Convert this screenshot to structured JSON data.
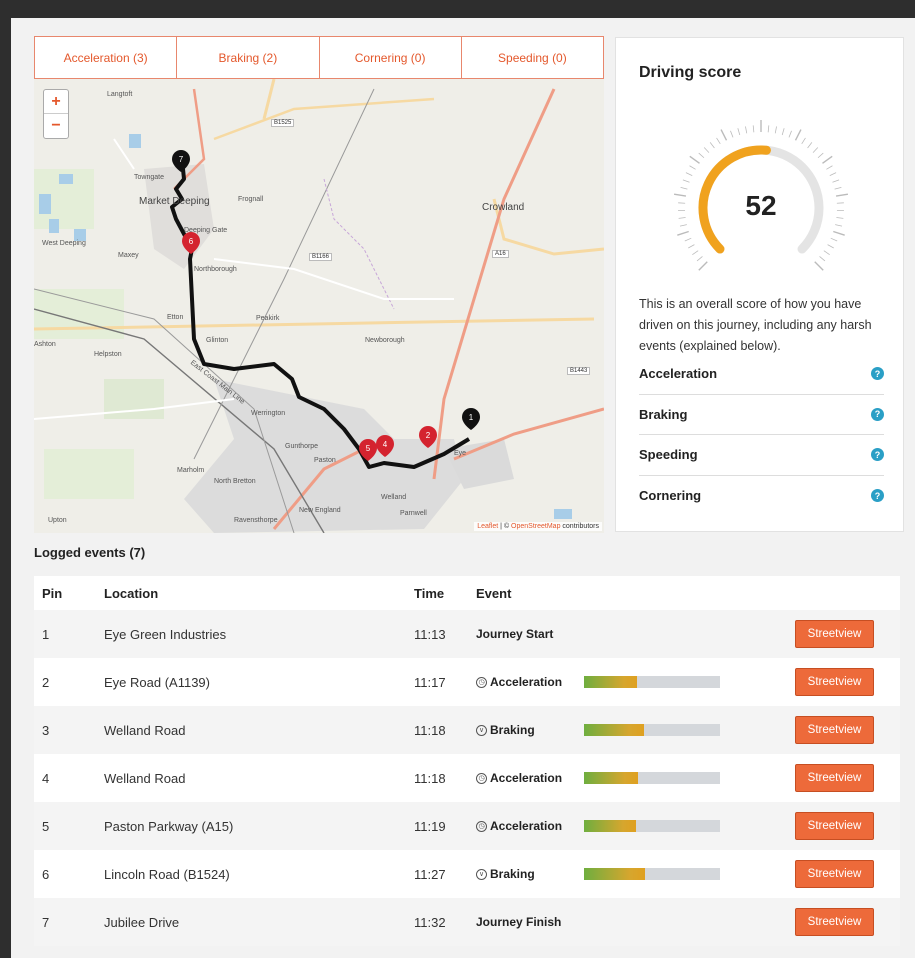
{
  "tabs": [
    {
      "label": "Acceleration (3)"
    },
    {
      "label": "Braking (2)"
    },
    {
      "label": "Cornering (0)"
    },
    {
      "label": "Speeding (0)"
    }
  ],
  "map": {
    "zoom_in": "+",
    "zoom_out": "−",
    "attribution_leaflet": "Leaflet",
    "attribution_sep": " | © ",
    "attribution_osm": "OpenStreetMap",
    "attribution_tail": " contributors",
    "places": {
      "langtoft": "Langtoft",
      "towngate": "Towngate",
      "market_deeping": "Market Deeping",
      "frognall": "Frognall",
      "deeping_gate": "Deeping Gate",
      "west_deeping": "West Deeping",
      "maxey": "Maxey",
      "northborough": "Northborough",
      "etton": "Etton",
      "peakirk": "Peakirk",
      "glinton": "Glinton",
      "helpston": "Helpston",
      "ashton": "Ashton",
      "newborough": "Newborough",
      "crowland": "Crowland",
      "werrington": "Werrington",
      "gunthorpe": "Gunthorpe",
      "paston": "Paston",
      "marholm": "Marholm",
      "north_bretton": "North Bretton",
      "welland": "Welland",
      "parnwell": "Parnwell",
      "new_england": "New England",
      "ravensthorpe": "Ravensthorpe",
      "upton": "Upton",
      "eye": "Eye",
      "east_coast_main_line": "East Coast Main Line"
    },
    "roads": {
      "b1525": "B1525",
      "b1166": "B1166",
      "a16": "A16",
      "b1443": "B1443"
    },
    "pins": [
      "1",
      "2",
      "5",
      "4",
      "6",
      "7"
    ]
  },
  "score": {
    "title": "Driving score",
    "value": 52,
    "max": 100,
    "description": "This is an overall score of how you have driven on this journey, including any harsh events (explained below).",
    "rows": [
      {
        "label": "Acceleration"
      },
      {
        "label": "Braking"
      },
      {
        "label": "Speeding"
      },
      {
        "label": "Cornering"
      }
    ],
    "help_glyph": "?",
    "colors": {
      "arc": "#f0a21e",
      "track": "#e4e4e4"
    }
  },
  "events": {
    "title": "Logged events (7)",
    "headers": {
      "pin": "Pin",
      "location": "Location",
      "time": "Time",
      "event": "Event"
    },
    "button_label": "Streetview",
    "rows": [
      {
        "pin": "1",
        "location": "Eye Green Industries",
        "time": "11:13",
        "event": "Journey Start",
        "icon": "",
        "severity": null
      },
      {
        "pin": "2",
        "location": "Eye Road (A1139)",
        "time": "11:17",
        "event": "Acceleration",
        "icon": "clock-icon",
        "severity": 0.39
      },
      {
        "pin": "3",
        "location": "Welland Road",
        "time": "11:18",
        "event": "Braking",
        "icon": "chevron-circle-icon",
        "severity": 0.44
      },
      {
        "pin": "4",
        "location": "Welland Road",
        "time": "11:18",
        "event": "Acceleration",
        "icon": "clock-icon",
        "severity": 0.4
      },
      {
        "pin": "5",
        "location": "Paston Parkway (A15)",
        "time": "11:19",
        "event": "Acceleration",
        "icon": "clock-icon",
        "severity": 0.38
      },
      {
        "pin": "6",
        "location": "Lincoln Road (B1524)",
        "time": "11:27",
        "event": "Braking",
        "icon": "chevron-circle-icon",
        "severity": 0.45
      },
      {
        "pin": "7",
        "location": "Jubilee Drive",
        "time": "11:32",
        "event": "Journey Finish",
        "icon": "",
        "severity": null
      }
    ]
  }
}
